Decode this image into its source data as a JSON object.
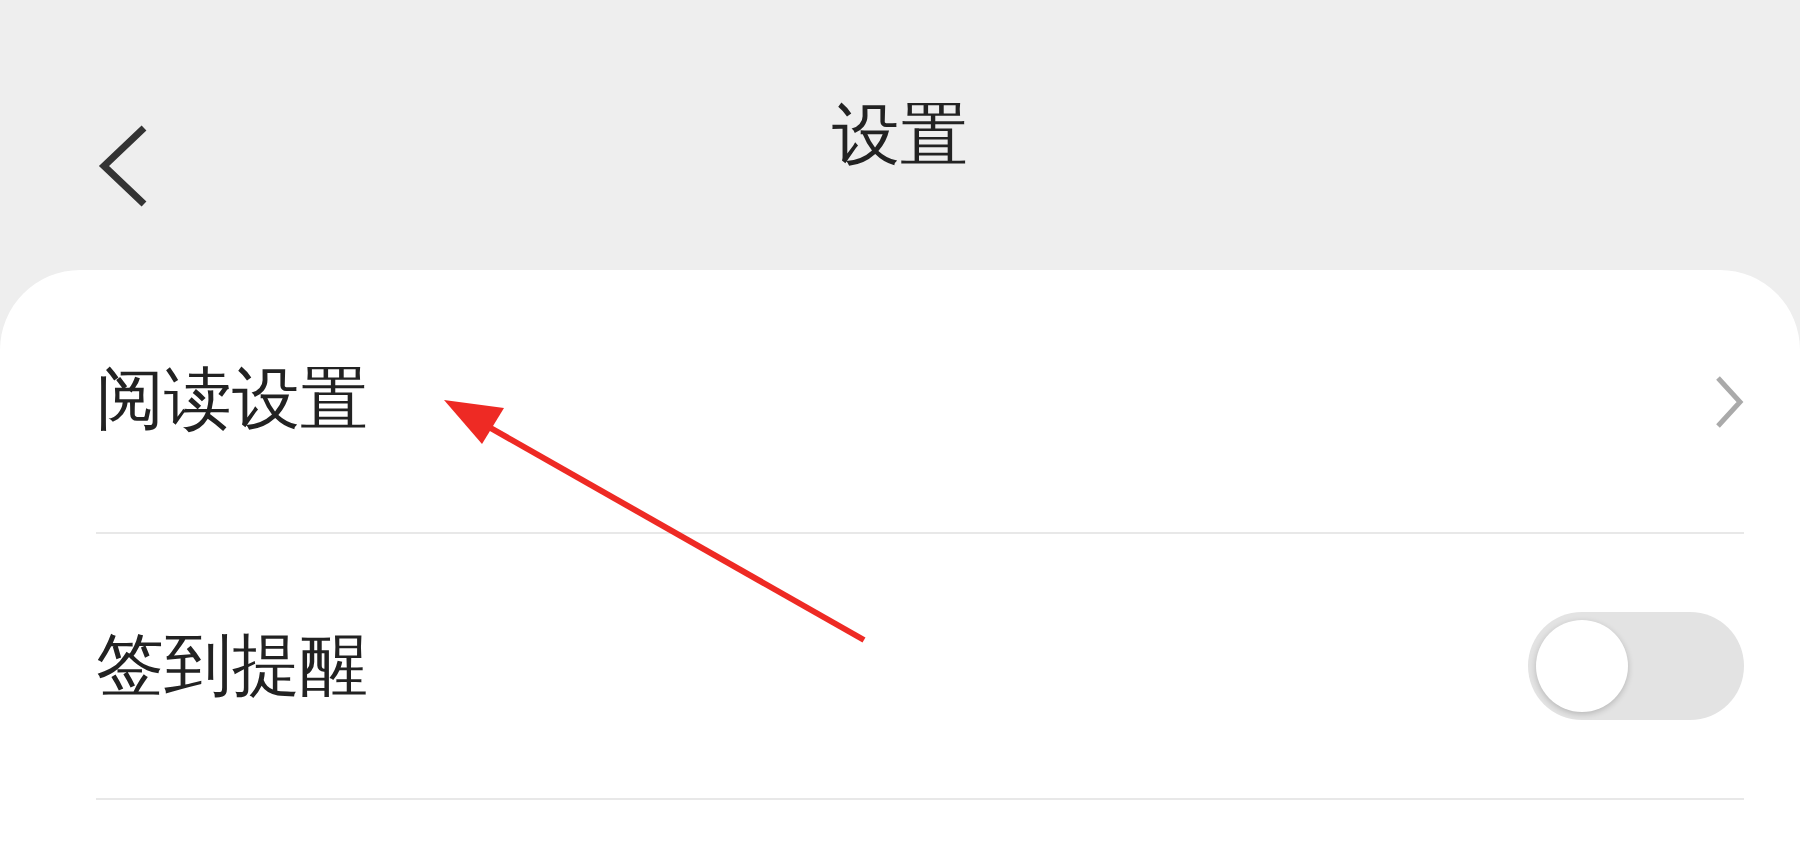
{
  "header": {
    "title": "设置"
  },
  "rows": [
    {
      "kind": "link",
      "label": "阅读设置"
    },
    {
      "kind": "switch",
      "label": "签到提醒",
      "on": false
    }
  ]
}
